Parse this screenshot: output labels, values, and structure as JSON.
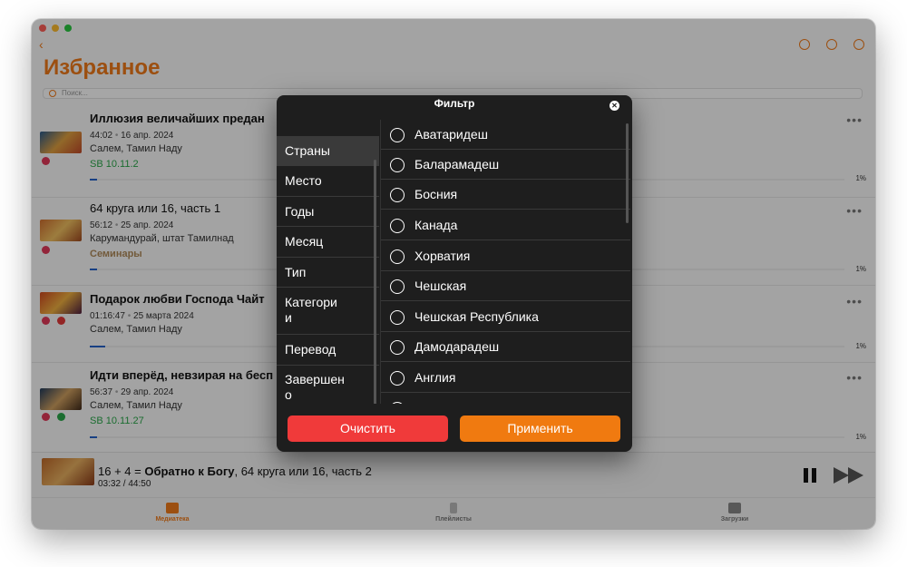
{
  "window": {
    "page_title": "Избранное",
    "search_placeholder": "Поиск..."
  },
  "items": [
    {
      "title": "Иллюзия величайших предан",
      "title_number": "",
      "duration": "44:02",
      "date": "16 апр. 2024",
      "place": "Салем, Тамил Наду",
      "tag": "SB 10.11.2",
      "tag_color": "#2aa84a",
      "progress_pct": 1,
      "progress_label": "1%"
    },
    {
      "title_number": "64 круга или 16, часть 1",
      "title": "",
      "duration": "56:12",
      "date": "25 апр. 2024",
      "place": "Карумандурай, штат Тамилнад",
      "tag": "Семинары",
      "tag_color": "#b08a5a",
      "progress_pct": 1,
      "progress_label": "1%"
    },
    {
      "title": "Подарок любви Господа Чайт",
      "title_number": "",
      "duration": "01:16:47",
      "date": "25 марта 2024",
      "place": "Салем, Тамил Наду",
      "tag": "",
      "tag_color": "#2aa84a",
      "progress_pct": 3,
      "progress_label": "1%"
    },
    {
      "title": "Идти вперёд, невзирая на бесп",
      "title_number": "",
      "duration": "56:37",
      "date": "29 апр. 2024",
      "place": "Салем, Тамил Наду",
      "tag": "SB 10.11.27",
      "tag_color": "#2aa84a",
      "progress_pct": 1,
      "progress_label": "1%"
    }
  ],
  "player": {
    "title_prefix": "16 + 4 = ",
    "title_bold": "Обратно к Богу",
    "title_suffix": ", 64 круга или 16, часть 2",
    "time": "03:32 / 44:50"
  },
  "tabs": [
    {
      "label": "Медиатека",
      "color": "#f07a1a"
    },
    {
      "label": "Плейлисты",
      "color": "#777777"
    },
    {
      "label": "Загрузки",
      "color": "#777777"
    }
  ],
  "filter": {
    "title": "Фильтр",
    "categories": [
      "Страны",
      "Место",
      "Годы",
      "Месяц",
      "Тип",
      "Категори\nи",
      "Перевод",
      "Завершен\nо"
    ],
    "active_category": "Страны",
    "options": [
      "Аватаридеш",
      "Баларамадеш",
      "Босния",
      "Канада",
      "Хорватия",
      "Чешская",
      "Чешская Республика",
      "Дамодарадеш",
      "Англия"
    ],
    "clear_label": "Очистить",
    "apply_label": "Применить"
  },
  "colors": {
    "accent": "#f07a1a",
    "clear_button": "#f03a3a",
    "apply_button": "#f07a10",
    "modal_bg": "#1e1e1e"
  }
}
